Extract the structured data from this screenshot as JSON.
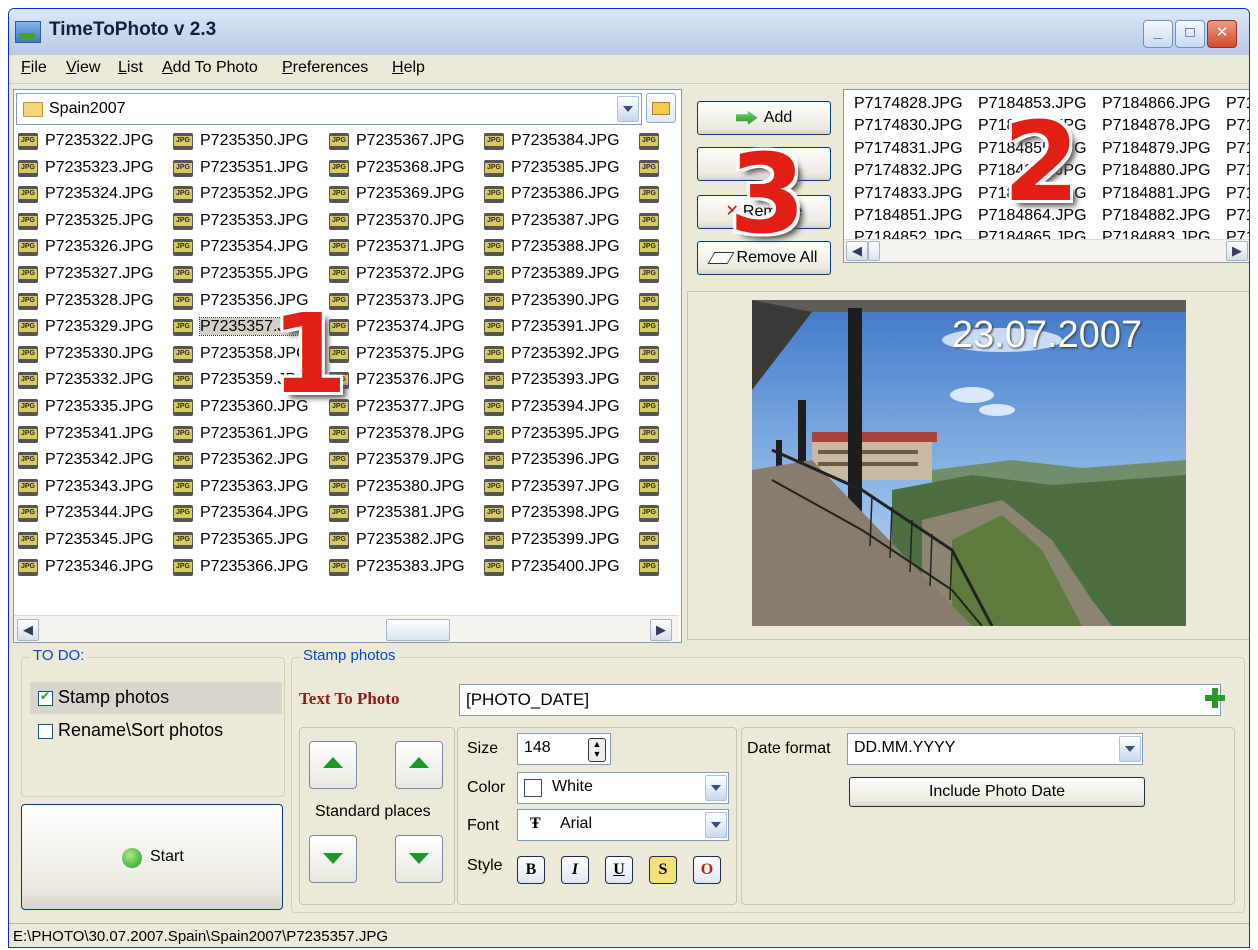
{
  "window": {
    "title": "TimeToPhoto v 2.3"
  },
  "menu": [
    "File",
    "View",
    "List",
    "Add To Photo",
    "Preferences",
    "Help"
  ],
  "folder": {
    "name": "Spain2007"
  },
  "file_columns": [
    [
      "P7235322.JPG",
      "P7235323.JPG",
      "P7235324.JPG",
      "P7235325.JPG",
      "P7235326.JPG",
      "P7235327.JPG",
      "P7235328.JPG",
      "P7235329.JPG",
      "P7235330.JPG",
      "P7235332.JPG",
      "P7235335.JPG",
      "P7235341.JPG",
      "P7235342.JPG",
      "P7235343.JPG",
      "P7235344.JPG",
      "P7235345.JPG",
      "P7235346.JPG"
    ],
    [
      "P7235350.JPG",
      "P7235351.JPG",
      "P7235352.JPG",
      "P7235353.JPG",
      "P7235354.JPG",
      "P7235355.JPG",
      "P7235356.JPG",
      "P7235357.JPG",
      "P7235358.JPG",
      "P7235359.JPG",
      "P7235360.JPG",
      "P7235361.JPG",
      "P7235362.JPG",
      "P7235363.JPG",
      "P7235364.JPG",
      "P7235365.JPG",
      "P7235366.JPG"
    ],
    [
      "P7235367.JPG",
      "P7235368.JPG",
      "P7235369.JPG",
      "P7235370.JPG",
      "P7235371.JPG",
      "P7235372.JPG",
      "P7235373.JPG",
      "P7235374.JPG",
      "P7235375.JPG",
      "P7235376.JPG",
      "P7235377.JPG",
      "P7235378.JPG",
      "P7235379.JPG",
      "P7235380.JPG",
      "P7235381.JPG",
      "P7235382.JPG",
      "P7235383.JPG"
    ],
    [
      "P7235384.JPG",
      "P7235385.JPG",
      "P7235386.JPG",
      "P7235387.JPG",
      "P7235388.JPG",
      "P7235389.JPG",
      "P7235390.JPG",
      "P7235391.JPG",
      "P7235392.JPG",
      "P7235393.JPG",
      "P7235394.JPG",
      "P7235395.JPG",
      "P7235396.JPG",
      "P7235397.JPG",
      "P7235398.JPG",
      "P7235399.JPG",
      "P7235400.JPG"
    ]
  ],
  "selected_file": "P7235357.JPG",
  "list_buttons": {
    "add": "Add",
    "add_all": "Add All",
    "remove": "Remove",
    "remove_all": "Remove All"
  },
  "added_columns": [
    [
      "P7174828.JPG",
      "P7174830.JPG",
      "P7174831.JPG",
      "P7174832.JPG",
      "P7174833.JPG",
      "P7184851.JPG",
      "P7184852.JPG"
    ],
    [
      "P7184853.JPG",
      "P7184854.JPG",
      "P7184855.JPG",
      "P7184856.JPG",
      "P7184857.JPG",
      "P7184864.JPG",
      "P7184865.JPG"
    ],
    [
      "P7184866.JPG",
      "P7184878.JPG",
      "P7184879.JPG",
      "P7184880.JPG",
      "P7184881.JPG",
      "P7184882.JPG",
      "P7184883.JPG"
    ],
    [
      "P71",
      "P71",
      "P71",
      "P71",
      "P71",
      "P71",
      "P71"
    ]
  ],
  "preview": {
    "stamp_text": "23.07.2007"
  },
  "annotations": [
    "1",
    "2",
    "3"
  ],
  "todo": {
    "title": "TO DO:",
    "stamp": "Stamp photos",
    "rename": "Rename\\Sort photos",
    "stamp_checked": true,
    "rename_checked": false
  },
  "start_label": "Start",
  "stamp": {
    "title": "Stamp photos",
    "text_label": "Text To Photo",
    "text_value": "[PHOTO_DATE]",
    "standard_places": "Standard places",
    "size_label": "Size",
    "size_value": "148",
    "color_label": "Color",
    "color_value": "White",
    "font_label": "Font",
    "font_value": "Arial",
    "style_label": "Style",
    "style_buttons": [
      "B",
      "I",
      "U",
      "S",
      "O"
    ],
    "date_format_label": "Date format",
    "date_format_value": "DD.MM.YYYY",
    "include_date_label": "Include Photo Date"
  },
  "status": {
    "path": "E:\\PHOTO\\30.07.2007.Spain\\Spain2007\\P7235357.JPG"
  },
  "colors": {
    "accent_red": "#e21f14",
    "title_blue": "#0046d5",
    "label_dark_red": "#8b1a1a"
  }
}
